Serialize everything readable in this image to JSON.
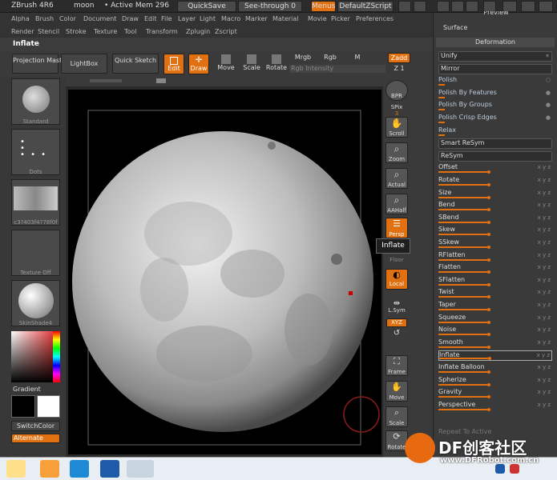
{
  "titlebar": {
    "app": "ZBrush 4R6",
    "doc": "moon",
    "mem": "• Active Mem 296",
    "quicksave": "QuickSave",
    "seethrough": "See-through  0",
    "menus": "Menus",
    "script": "DefaultZScript"
  },
  "menus": [
    "Alpha",
    "Brush",
    "Color",
    "Document",
    "Draw",
    "Edit",
    "File",
    "Layer",
    "Light",
    "Macro",
    "Marker",
    "Material",
    "Movie",
    "Picker",
    "Preferences"
  ],
  "menus2": [
    "Render",
    "Stencil",
    "Stroke",
    "Texture",
    "Tool",
    "Transform",
    "Zplugin",
    "Zscript"
  ],
  "tool_title": "Inflate",
  "shelf": {
    "projection_master": "Projection Master",
    "lightbox": "LightBox",
    "quick_sketch": "Quick Sketch",
    "edit": "Edit",
    "draw": "Draw",
    "move": "Move",
    "scale": "Scale",
    "rotate": "Rotate",
    "mrgb": "Mrgb",
    "rgb": "Rgb",
    "m": "M",
    "zadd": "Zadd",
    "zsub": "Z 1",
    "rgb_intensity": "Rgb Intensity"
  },
  "left_tray": {
    "items": [
      "Standard",
      "Dots",
      "c3?403f4?78f0f",
      "Texture Off",
      "SkinShade4"
    ],
    "gradient": "Gradient",
    "switch_color": "SwitchColor",
    "alternate": "Alternate"
  },
  "right_strip": {
    "bpr": "BPR",
    "spix": "SPix",
    "spix_val": "3",
    "scroll": "Scroll",
    "zoom": "Zoom",
    "actual": "Actual",
    "aahalf": "AAHalf",
    "persp": "Persp",
    "floor": "Floor",
    "local": "Local",
    "lsym": "L.Sym",
    "xyz": "XYZ",
    "frame": "Frame",
    "move": "Move",
    "scale": "Scale",
    "rotate": "Rotate"
  },
  "tooltip": "Inflate",
  "palette": {
    "preview": "Preview",
    "surface": "Surface",
    "deformation": "Deformation",
    "rows": [
      {
        "label": "Unify",
        "type": "btn",
        "tag": "✶"
      },
      {
        "label": "Mirror",
        "type": "btn",
        "tag": ""
      },
      {
        "label": "Polish",
        "type": "slider",
        "tag": "○"
      },
      {
        "label": "Polish By Features",
        "type": "slider",
        "tag": "●"
      },
      {
        "label": "Polish By Groups",
        "type": "slider",
        "tag": "●"
      },
      {
        "label": "Polish Crisp Edges",
        "type": "slider",
        "tag": "●"
      },
      {
        "label": "Relax",
        "type": "slider",
        "tag": ""
      },
      {
        "label": "Smart ReSym",
        "type": "btn",
        "tag": ""
      },
      {
        "label": "ReSym",
        "type": "btn",
        "tag": ""
      },
      {
        "label": "Offset",
        "type": "slider",
        "tag": "x y z"
      },
      {
        "label": "Rotate",
        "type": "slider",
        "tag": "x y z"
      },
      {
        "label": "Size",
        "type": "slider",
        "tag": "x y z"
      },
      {
        "label": "Bend",
        "type": "slider",
        "tag": "x y z"
      },
      {
        "label": "SBend",
        "type": "slider",
        "tag": "x y z"
      },
      {
        "label": "Skew",
        "type": "slider",
        "tag": "x y z"
      },
      {
        "label": "SSkew",
        "type": "slider",
        "tag": "x y z"
      },
      {
        "label": "RFlatten",
        "type": "slider",
        "tag": "x y z"
      },
      {
        "label": "Flatten",
        "type": "slider",
        "tag": "x y z"
      },
      {
        "label": "SFlatten",
        "type": "slider",
        "tag": "x y z"
      },
      {
        "label": "Twist",
        "type": "slider",
        "tag": "x y z"
      },
      {
        "label": "Taper",
        "type": "slider",
        "tag": "x y z"
      },
      {
        "label": "Squeeze",
        "type": "slider",
        "tag": "x y z"
      },
      {
        "label": "Noise",
        "type": "slider",
        "tag": "x y z"
      },
      {
        "label": "Smooth",
        "type": "slider",
        "tag": "x y z"
      },
      {
        "label": "Inflate",
        "type": "hl",
        "tag": "x y z"
      },
      {
        "label": "Inflate Balloon",
        "type": "slider",
        "tag": "x y z"
      },
      {
        "label": "Spherize",
        "type": "slider",
        "tag": "x y z"
      },
      {
        "label": "Gravity",
        "type": "slider",
        "tag": "x y z"
      },
      {
        "label": "Perspective",
        "type": "slider",
        "tag": "x y z"
      }
    ],
    "repeat": "Repeat To Active"
  },
  "watermark": {
    "brand": "DF创客社区",
    "url": "www.DFRobot.com.cn"
  },
  "colors": {
    "accent": "#e07010",
    "panel": "#3a3a3a"
  }
}
